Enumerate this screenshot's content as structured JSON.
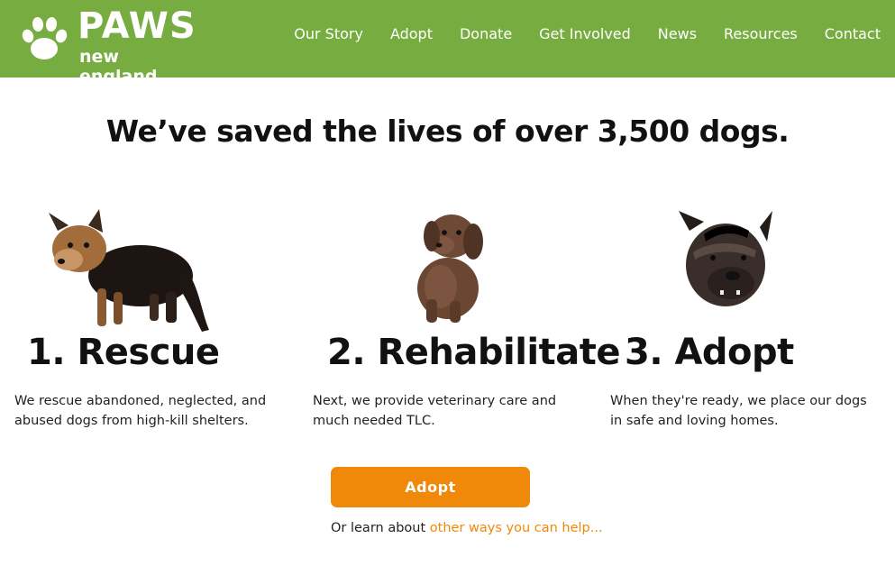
{
  "brand": {
    "title": "PAWS",
    "subtitle": "new england",
    "colors": {
      "header": "#77ad40",
      "accent": "#f0890a"
    }
  },
  "nav": {
    "items": [
      "Our Story",
      "Adopt",
      "Donate",
      "Get Involved",
      "News",
      "Resources",
      "Contact"
    ]
  },
  "headline": "We’ve saved the lives of over 3,500 dogs.",
  "steps": [
    {
      "title": "1. Rescue",
      "description": "We rescue abandoned, neglected, and abused dogs from high-kill shelters.",
      "image": "scruffy-terrier-dog-photo"
    },
    {
      "title": "2. Rehabilitate",
      "description": "Next, we provide veterinary care and much needed TLC.",
      "image": "dachshund-puppy-photo"
    },
    {
      "title": "3. Adopt",
      "description": "When they're ready, we place our dogs in safe and loving homes.",
      "image": "boxer-mix-dog-photo"
    }
  ],
  "cta": {
    "button_label": "Adopt",
    "learn_prefix": "Or learn about",
    "learn_link": "other ways you can help..."
  }
}
